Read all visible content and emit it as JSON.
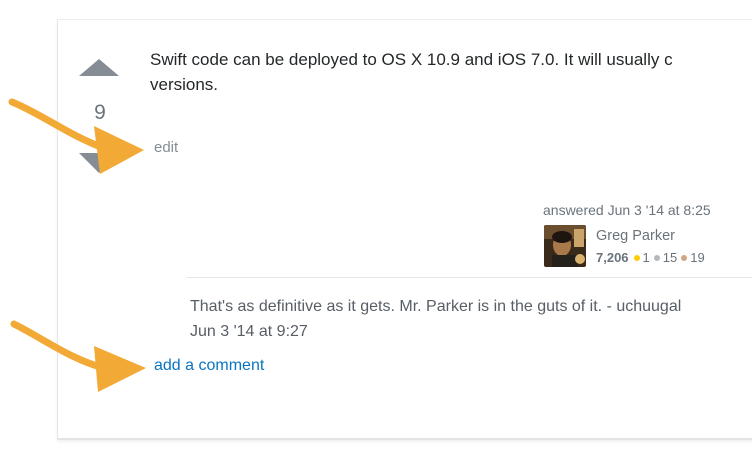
{
  "vote": {
    "count": "9",
    "up_icon": "triangle-up-icon",
    "down_icon": "triangle-down-icon"
  },
  "answer": {
    "line1": "Swift code can be deployed to OS X 10.9 and iOS 7.0. It will usually c",
    "line2": "versions.",
    "edit_label": "edit"
  },
  "author": {
    "answered_label": "answered Jun 3 '14 at 8:25",
    "name": "Greg Parker",
    "reputation": "7,206",
    "gold": "1",
    "silver": "15",
    "bronze": "19"
  },
  "comment": {
    "line1": "That's as definitive as it gets. Mr. Parker is in the guts of it. - uchuugal",
    "line2": "Jun 3 '14 at 9:27"
  },
  "add_comment_label": "add a comment",
  "colors": {
    "link": "#0a74c2",
    "arrow": "#f3a935",
    "gold": "#ffcc01",
    "silver": "#b4b8bc",
    "bronze": "#d1a684",
    "vote_arrow": "#858c93"
  }
}
